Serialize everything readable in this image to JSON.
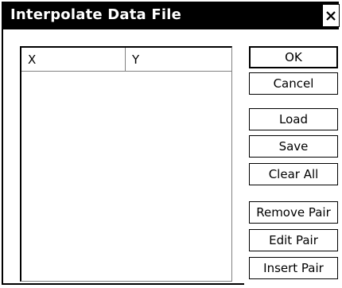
{
  "window": {
    "title": "Interpolate Data File",
    "close_icon": "close-icon"
  },
  "list": {
    "columns": [
      "X",
      "Y"
    ],
    "rows": []
  },
  "buttons": {
    "ok": "OK",
    "cancel": "Cancel",
    "load": "Load",
    "save": "Save",
    "clear_all": "Clear All",
    "remove_pair": "Remove Pair",
    "edit_pair": "Edit Pair",
    "insert_pair": "Insert Pair"
  }
}
